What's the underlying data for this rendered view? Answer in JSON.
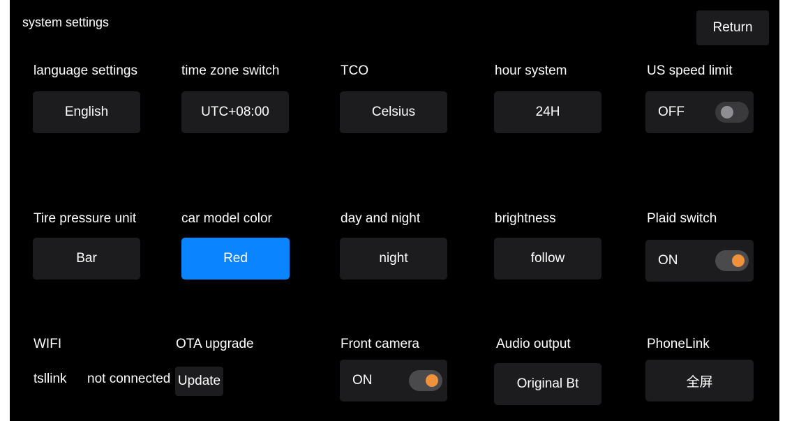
{
  "header": {
    "title": "system settings",
    "return_label": "Return"
  },
  "row1": {
    "language": {
      "label": "language settings",
      "value": "English"
    },
    "timezone": {
      "label": "time zone switch",
      "value": "UTC+08:00"
    },
    "tco": {
      "label": "TCO",
      "value": "Celsius"
    },
    "hour": {
      "label": "hour system",
      "value": "24H"
    },
    "us_speed": {
      "label": "US speed limit",
      "state": "OFF"
    }
  },
  "row2": {
    "tire": {
      "label": "Tire pressure unit",
      "value": "Bar"
    },
    "car_color": {
      "label": "car model color",
      "value": "Red"
    },
    "day_night": {
      "label": "day and night",
      "value": "night"
    },
    "brightness": {
      "label": "brightness",
      "value": "follow"
    },
    "plaid": {
      "label": "Plaid switch",
      "state": "ON"
    }
  },
  "row3": {
    "wifi": {
      "label": "WIFI",
      "ssid": "tsllink",
      "status": "not connected"
    },
    "ota": {
      "label": "OTA upgrade",
      "button": "Update"
    },
    "front_camera": {
      "label": "Front camera",
      "state": "ON"
    },
    "audio": {
      "label": "Audio output",
      "value": "Original Bt"
    },
    "phonelink": {
      "label": "PhoneLink",
      "value": "全屏"
    }
  },
  "colors": {
    "accent_blue": "#0a84ff",
    "toggle_on": "#f0913b",
    "background": "#000000",
    "tile": "#1c1c1e"
  }
}
